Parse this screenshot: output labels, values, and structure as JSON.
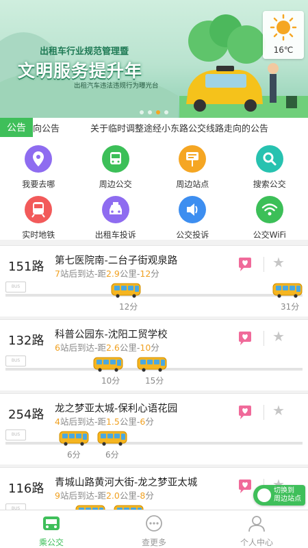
{
  "banner": {
    "line1": "出租车行业规范管理暨",
    "line2": "文明服务提升年",
    "line3": "出租汽车违法违规行为曝光台",
    "weather_temp": "16℃",
    "weather_icon": "sun-icon",
    "page_index": 3,
    "page_count": 4
  },
  "notice": {
    "tag": "公告",
    "text_partial": "向公告",
    "text": "关于临时调整途经小东路公交线路走向的公告"
  },
  "grid": [
    {
      "label": "我要去哪",
      "icon": "location-pin-icon",
      "color": "#8e6cf0"
    },
    {
      "label": "周边公交",
      "icon": "bus-icon",
      "color": "#3cbf58"
    },
    {
      "label": "周边站点",
      "icon": "bus-stop-sign-icon",
      "color": "#f5a623"
    },
    {
      "label": "搜索公交",
      "icon": "search-icon",
      "color": "#27c2b0"
    },
    {
      "label": "实时地铁",
      "icon": "subway-icon",
      "color": "#f25a5a"
    },
    {
      "label": "出租车投诉",
      "icon": "taxi-icon",
      "color": "#8e6cf0"
    },
    {
      "label": "公交投诉",
      "icon": "speaker-icon",
      "color": "#3d8ef0"
    },
    {
      "label": "公交WiFi",
      "icon": "wifi-icon",
      "color": "#3cbf58"
    }
  ],
  "routes": [
    {
      "number": "151路",
      "name": "第七医院南-二台子街观泉路",
      "stops": "7",
      "dist": "2.9",
      "mins": "12",
      "info_a": "站后到达-距",
      "info_b": "公里-",
      "info_c": "分",
      "buses": [
        {
          "eta": "12分"
        },
        {
          "eta": "31分"
        }
      ]
    },
    {
      "number": "132路",
      "name": "科普公园东-沈阳工贸学校",
      "stops": "6",
      "dist": "2.6",
      "mins": "10",
      "info_a": "站后到达-距",
      "info_b": "公里-",
      "info_c": "分",
      "buses": [
        {
          "eta": "10分"
        },
        {
          "eta": "15分"
        }
      ]
    },
    {
      "number": "254路",
      "name": "龙之梦亚太城-保利心语花园",
      "stops": "4",
      "dist": "1.5",
      "mins": "6",
      "info_a": "站后到达-距",
      "info_b": "公里-",
      "info_c": "分",
      "buses": [
        {
          "eta": "6分"
        },
        {
          "eta": "6分"
        }
      ]
    },
    {
      "number": "116路",
      "name": "青城山路黄河大街-龙之梦亚太城",
      "stops": "9",
      "dist": "2.0",
      "mins": "8",
      "info_a": "站后到达-距",
      "info_b": "公里-",
      "info_c": "分",
      "buses": [
        {
          "eta": ""
        },
        {
          "eta": ""
        }
      ]
    }
  ],
  "switch_button": {
    "line1": "切换到",
    "line2": "周边站点"
  },
  "tabs": [
    {
      "label": "乘公交",
      "icon": "bus-tab-icon",
      "active": true
    },
    {
      "label": "查更多",
      "icon": "more-chat-icon",
      "active": false
    },
    {
      "label": "个人中心",
      "icon": "user-icon",
      "active": false
    }
  ],
  "colors": {
    "primary": "#3fbf5a",
    "highlight": "#f0a020",
    "favorite": "#f06a9a"
  }
}
